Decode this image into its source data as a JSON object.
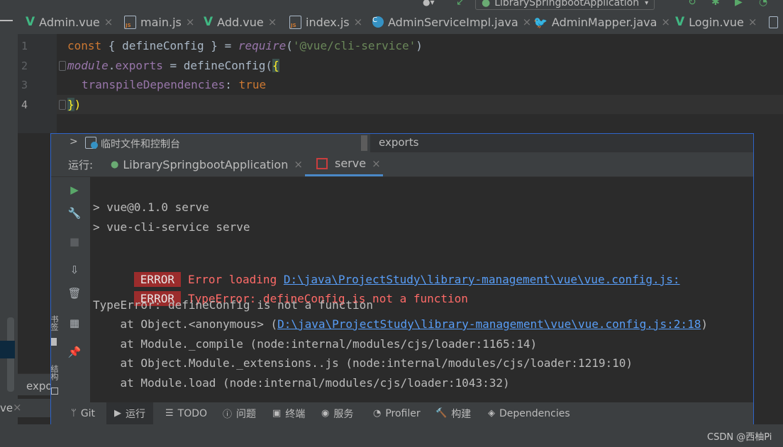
{
  "toolbar": {
    "run_config": "LibrarySpringbootApplication"
  },
  "tabs": [
    {
      "label": "Admin.vue",
      "icon": "vue-icon"
    },
    {
      "label": "main.js",
      "icon": "js-file-icon"
    },
    {
      "label": "Add.vue",
      "icon": "vue-icon"
    },
    {
      "label": "index.js",
      "icon": "js-file-icon"
    },
    {
      "label": "AdminServiceImpl.java",
      "icon": "java-class-icon"
    },
    {
      "label": "AdminMapper.java",
      "icon": "mybatis-icon"
    },
    {
      "label": "Login.vue",
      "icon": "vue-icon"
    }
  ],
  "editor": {
    "line_numbers": [
      "1",
      "2",
      "3",
      "4"
    ],
    "lines": [
      {
        "t1": "const",
        "t2": " { defineConfig } = ",
        "t3": "require",
        "t4": "(",
        "t5": "'@vue/cli-service'",
        "t6": ")"
      },
      {
        "t1": "module",
        "t2": ".",
        "t3": "exports",
        "t4": " = defineConfig(",
        "t5": "{"
      },
      {
        "t1": "transpileDependencies",
        "t2": ": ",
        "t3": "true"
      },
      {
        "t1": "}",
        "t2": ")"
      }
    ]
  },
  "breadcrumb": {
    "left": "临时文件和控制台",
    "right": "exports"
  },
  "run_panel": {
    "label": "运行:",
    "tabs": [
      {
        "label": "LibrarySpringbootApplication"
      },
      {
        "label": "serve"
      }
    ]
  },
  "console": {
    "cmd1": "> vue@0.1.0 serve",
    "cmd2": "> vue-cli-service serve",
    "error_badge": "ERROR",
    "err1_text": "Error loading ",
    "err1_link": "D:\\java\\ProjectStudy\\library-management\\vue\\vue.config.js:",
    "err2_text": "TypeError: defineConfig is not a function",
    "trace_head": "TypeError: defineConfig is not a function",
    "trace1_pre": "    at Object.<anonymous> (",
    "trace1_link": "D:\\java\\ProjectStudy\\library-management\\vue\\vue.config.js:2:18",
    "trace1_post": ")",
    "trace2": "    at Module._compile (node:internal/modules/cjs/loader:1165:14)",
    "trace3": "    at Object.Module._extensions..js (node:internal/modules/cjs/loader:1219:10)",
    "trace4": "    at Module.load (node:internal/modules/cjs/loader:1043:32)"
  },
  "side_labels": {
    "bookmarks": "书签",
    "structure": "结构"
  },
  "bottom_tabs": [
    "Git",
    "运行",
    "TODO",
    "问题",
    "终端",
    "服务",
    "Profiler",
    "构建",
    "Dependencies"
  ],
  "misc": {
    "left_tab_fragment": "expo",
    "bottom_fragment": "ve",
    "watermark": "CSDN @西柚Pi"
  }
}
